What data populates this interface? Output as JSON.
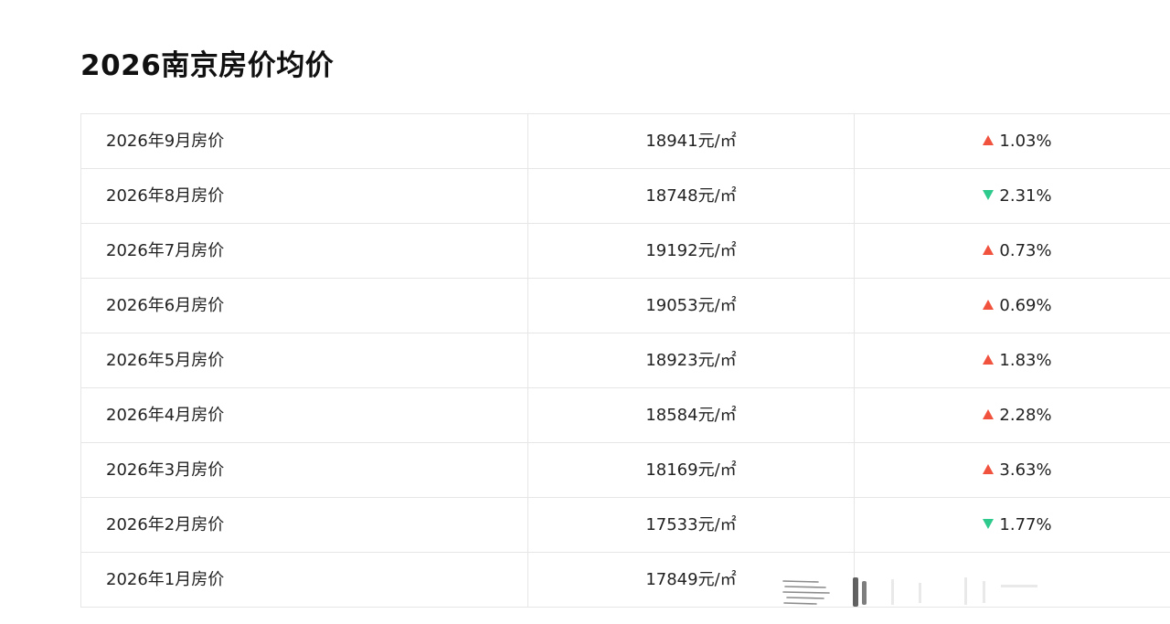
{
  "page": {
    "title": "2026南京房价均价"
  },
  "colors": {
    "up": "#f0523d",
    "down": "#2ec98c"
  },
  "table": {
    "rows": [
      {
        "month": "2026年9月房价",
        "price": "18941元/㎡",
        "direction": "up",
        "change": "1.03%"
      },
      {
        "month": "2026年8月房价",
        "price": "18748元/㎡",
        "direction": "down",
        "change": "2.31%"
      },
      {
        "month": "2026年7月房价",
        "price": "19192元/㎡",
        "direction": "up",
        "change": "0.73%"
      },
      {
        "month": "2026年6月房价",
        "price": "19053元/㎡",
        "direction": "up",
        "change": "0.69%"
      },
      {
        "month": "2026年5月房价",
        "price": "18923元/㎡",
        "direction": "up",
        "change": "1.83%"
      },
      {
        "month": "2026年4月房价",
        "price": "18584元/㎡",
        "direction": "up",
        "change": "2.28%"
      },
      {
        "month": "2026年3月房价",
        "price": "18169元/㎡",
        "direction": "up",
        "change": "3.63%"
      },
      {
        "month": "2026年2月房价",
        "price": "17533元/㎡",
        "direction": "down",
        "change": "1.77%"
      },
      {
        "month": "2026年1月房价",
        "price": "17849元/㎡",
        "direction": "none",
        "change": ""
      }
    ]
  }
}
